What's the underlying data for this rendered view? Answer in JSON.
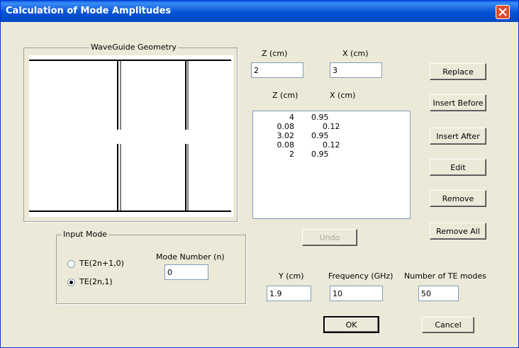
{
  "window": {
    "title": "Calculation of Mode Amplitudes"
  },
  "geometry_panel": {
    "legend": "WaveGuide Geometry"
  },
  "entry": {
    "z_label": "Z (cm)",
    "z_value": "2",
    "x_label": "X (cm)",
    "x_value": "3"
  },
  "list": {
    "z_header": "Z (cm)",
    "x_header": "X (cm)",
    "rows": [
      {
        "z": "4",
        "x": "0.95"
      },
      {
        "z": "0.08",
        "x": "0.12"
      },
      {
        "z": "3.02",
        "x": "0.95"
      },
      {
        "z": "0.08",
        "x": "0.12"
      },
      {
        "z": "2",
        "x": "0.95"
      }
    ]
  },
  "buttons": {
    "replace": "Replace",
    "insert_before": "Insert Before",
    "insert_after": "Insert After",
    "edit": "Edit",
    "remove": "Remove",
    "remove_all": "Remove All",
    "undo": "Undo",
    "ok": "OK",
    "cancel": "Cancel"
  },
  "input_mode": {
    "legend": "Input Mode",
    "options": [
      "TE(2n+1,0)",
      "TE(2n,1)"
    ],
    "selected": "TE(2n,1)",
    "mode_number_label": "Mode Number  (n)",
    "mode_number_value": "0"
  },
  "params": {
    "y_label": "Y (cm)",
    "y_value": "1.9",
    "freq_label": "Frequency (GHz)",
    "freq_value": "10",
    "modes_label": "Number of TE modes",
    "modes_value": "50"
  },
  "colors": {
    "title_bar": "#0552d3",
    "dialog_bg": "#ece9d8",
    "close_button": "#e04c2a"
  }
}
